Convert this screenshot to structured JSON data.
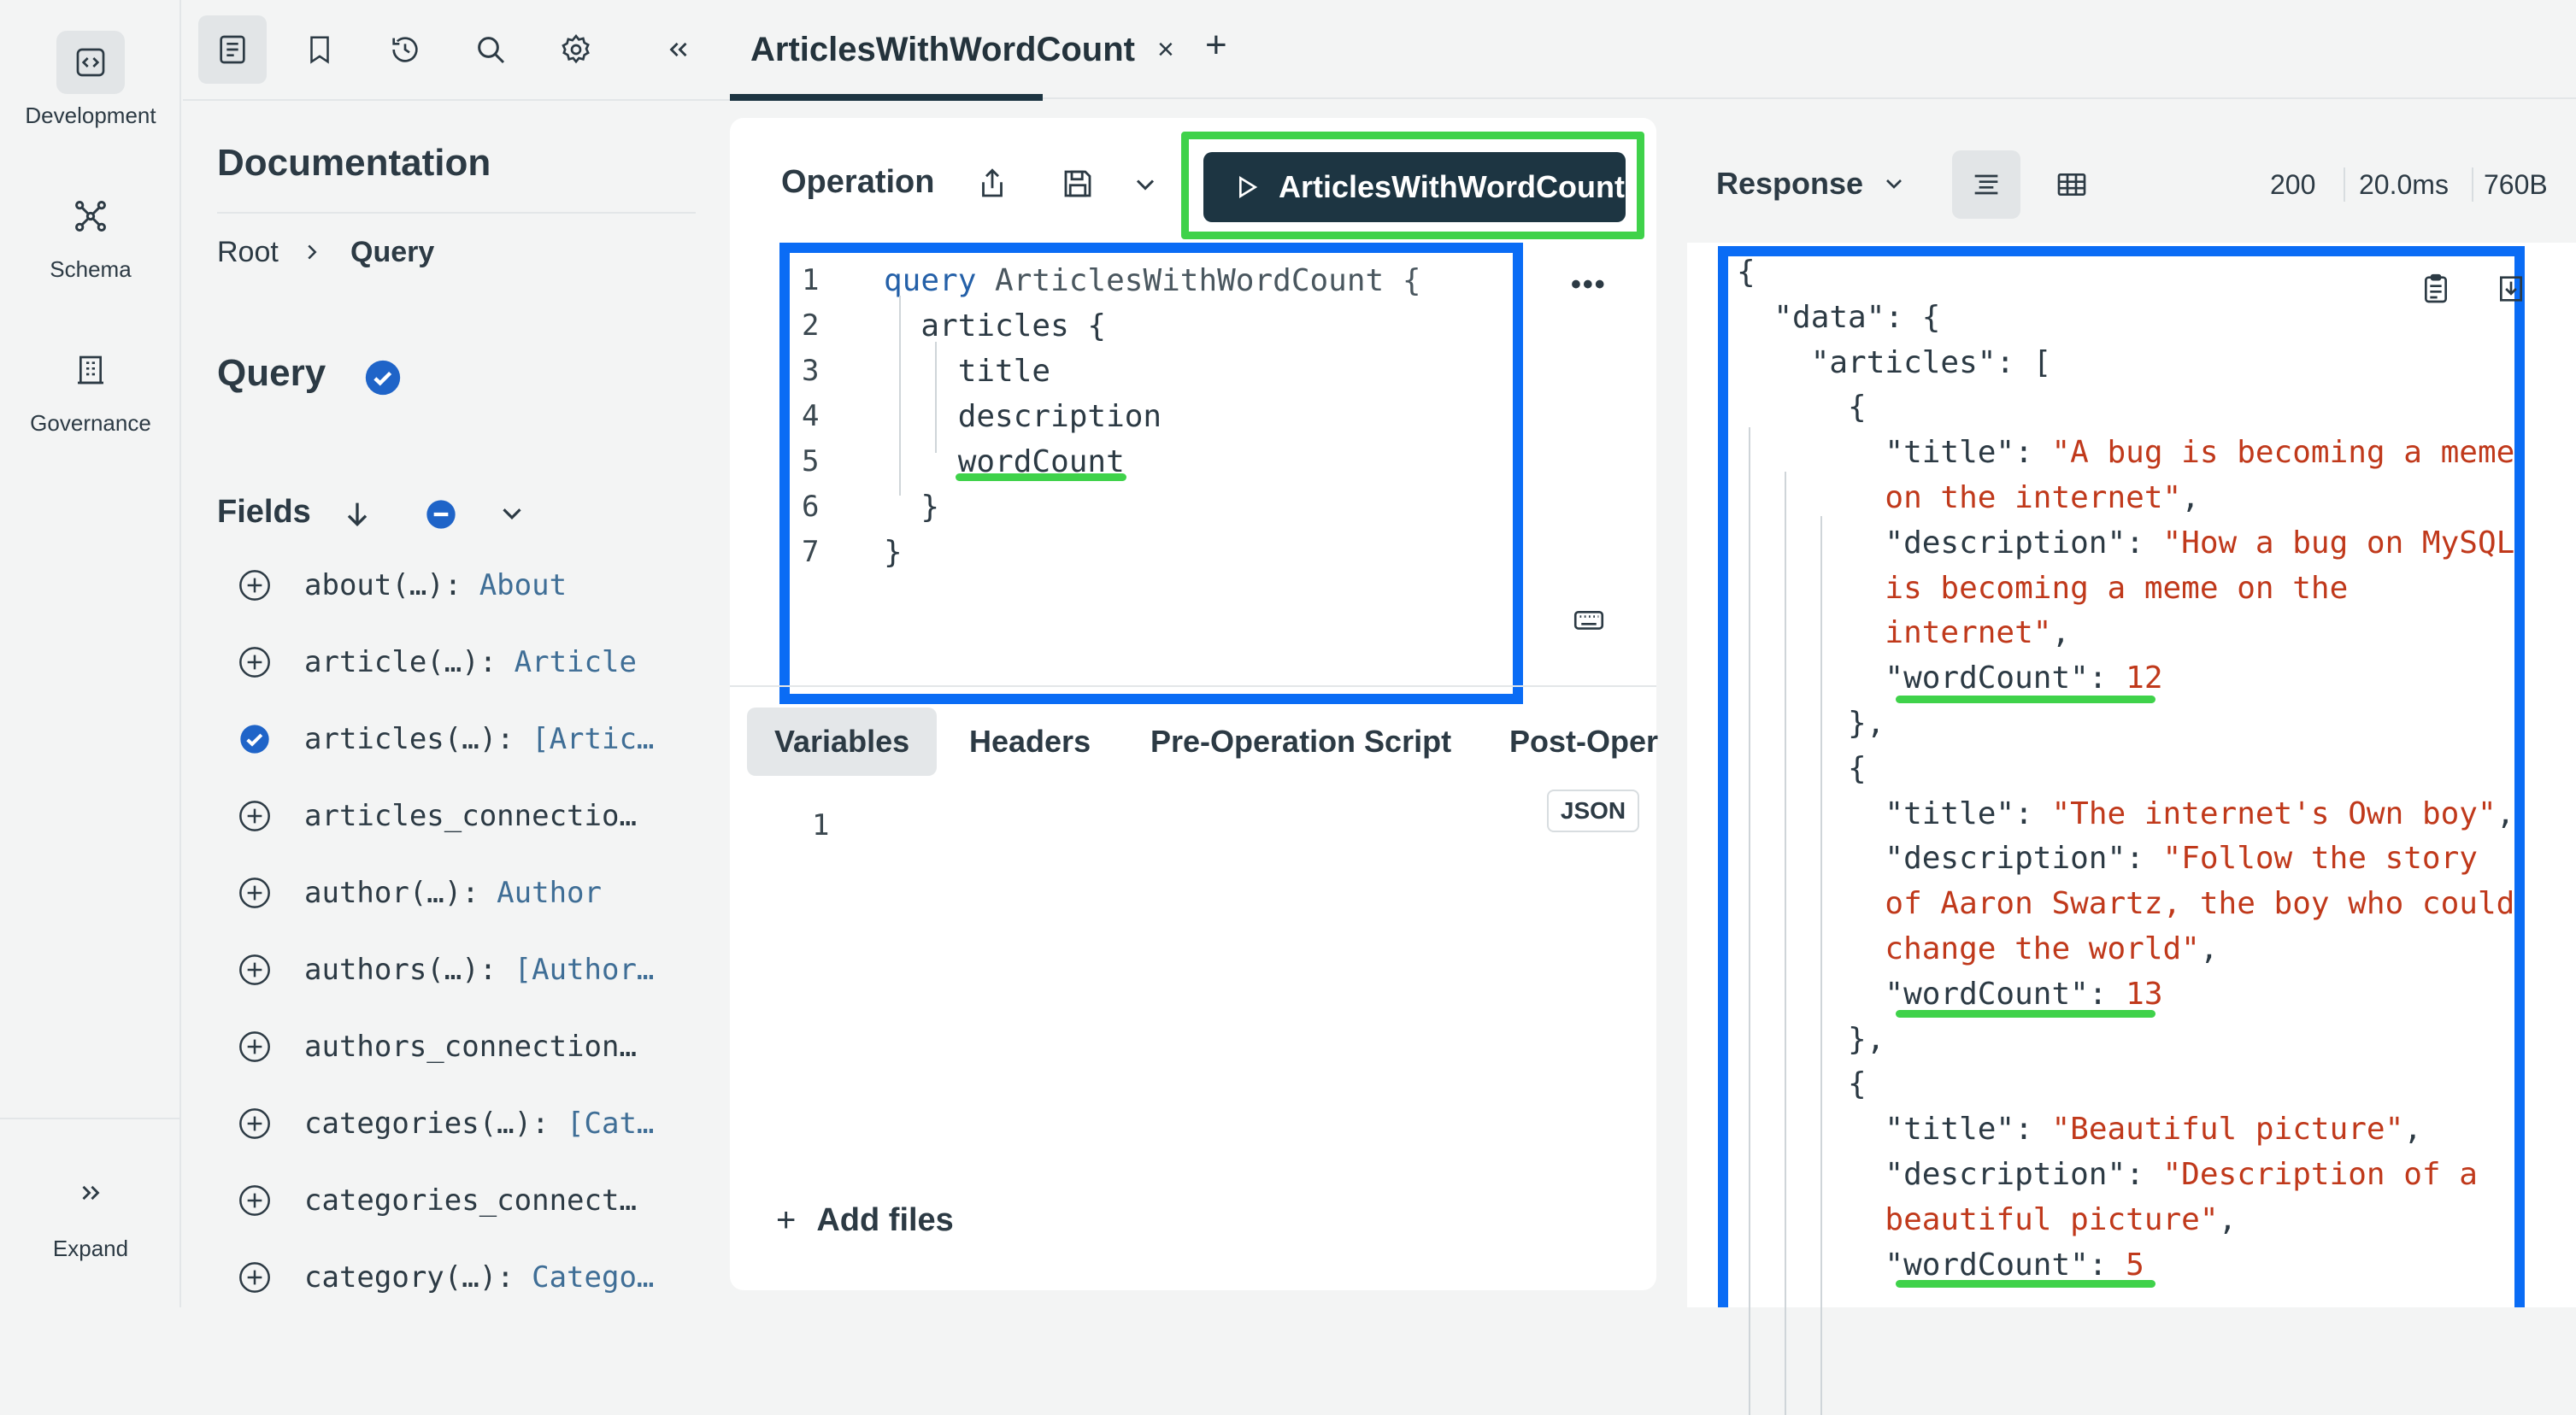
{
  "rail": {
    "items": [
      {
        "label": "Development",
        "icon": "code-brackets-icon"
      },
      {
        "label": "Schema",
        "icon": "graph-nodes-icon"
      },
      {
        "label": "Governance",
        "icon": "building-icon"
      }
    ],
    "expand_label": "Expand"
  },
  "docs": {
    "title": "Documentation",
    "breadcrumb": [
      "Root",
      "Query"
    ],
    "type_name": "Query",
    "fields_heading": "Fields",
    "fields": [
      {
        "name": "about(…): ",
        "type": "About",
        "selected": false
      },
      {
        "name": "article(…): ",
        "type": "Article",
        "selected": false
      },
      {
        "name": "articles(…): ",
        "type": "[Artic…",
        "selected": true
      },
      {
        "name": "articles_connectio…",
        "type": "",
        "selected": false
      },
      {
        "name": "author(…): ",
        "type": "Author",
        "selected": false
      },
      {
        "name": "authors(…): ",
        "type": "[Author…",
        "selected": false
      },
      {
        "name": "authors_connection…",
        "type": "",
        "selected": false
      },
      {
        "name": "categories(…): ",
        "type": "[Cat…",
        "selected": false
      },
      {
        "name": "categories_connect…",
        "type": "",
        "selected": false
      },
      {
        "name": "category(…): ",
        "type": "Catego…",
        "selected": false
      }
    ]
  },
  "tab": {
    "title": "ArticlesWithWordCount",
    "close": "×",
    "add": "+"
  },
  "operation": {
    "title": "Operation",
    "run_label": "ArticlesWithWordCount",
    "code_lines": [
      {
        "n": "1",
        "parts": [
          [
            "kw",
            "query"
          ],
          [
            "fn",
            " ArticlesWithWordCount {"
          ]
        ]
      },
      {
        "n": "2",
        "parts": [
          [
            "",
            "  articles {"
          ]
        ]
      },
      {
        "n": "3",
        "parts": [
          [
            "",
            "    title"
          ]
        ]
      },
      {
        "n": "4",
        "parts": [
          [
            "",
            "    description"
          ]
        ]
      },
      {
        "n": "5",
        "parts": [
          [
            "",
            "    wordCount"
          ]
        ]
      },
      {
        "n": "6",
        "parts": [
          [
            "",
            "  }"
          ]
        ]
      },
      {
        "n": "7",
        "parts": [
          [
            "",
            "}"
          ]
        ]
      }
    ],
    "sub_tabs": [
      "Variables",
      "Headers",
      "Pre-Operation Script",
      "Post-Oper"
    ],
    "variables_line": "1",
    "json_badge": "JSON",
    "add_files": "Add files"
  },
  "response": {
    "title": "Response",
    "status": "200",
    "time": "20.0ms",
    "size": "760B",
    "lines": [
      [
        [
          "",
          "{"
        ]
      ],
      [
        [
          "",
          "  \"data\": {"
        ]
      ],
      [
        [
          "",
          "    \"articles\": ["
        ]
      ],
      [
        [
          "",
          "      {"
        ]
      ],
      [
        [
          "",
          "        \"title\": "
        ],
        [
          "str",
          "\"A bug is becoming a meme"
        ]
      ],
      [
        [
          "str",
          "        on the internet\""
        ],
        [
          "",
          ","
        ]
      ],
      [
        [
          "",
          "        \"description\": "
        ],
        [
          "str",
          "\"How a bug on MySQL"
        ]
      ],
      [
        [
          "str",
          "        is becoming a meme on the"
        ]
      ],
      [
        [
          "str",
          "        internet\""
        ],
        [
          "",
          ","
        ]
      ],
      [
        [
          "",
          "        \"wordCount\": "
        ],
        [
          "num",
          "12"
        ]
      ],
      [
        [
          "",
          "      },"
        ]
      ],
      [
        [
          "",
          "      {"
        ]
      ],
      [
        [
          "",
          "        \"title\": "
        ],
        [
          "str",
          "\"The internet's Own boy\""
        ],
        [
          "",
          ","
        ]
      ],
      [
        [
          "",
          "        \"description\": "
        ],
        [
          "str",
          "\"Follow the story"
        ]
      ],
      [
        [
          "str",
          "        of Aaron Swartz, the boy who could"
        ]
      ],
      [
        [
          "str",
          "        change the world\""
        ],
        [
          "",
          ","
        ]
      ],
      [
        [
          "",
          "        \"wordCount\": "
        ],
        [
          "num",
          "13"
        ]
      ],
      [
        [
          "",
          "      },"
        ]
      ],
      [
        [
          "",
          "      {"
        ]
      ],
      [
        [
          "",
          "        \"title\": "
        ],
        [
          "str",
          "\"Beautiful picture\""
        ],
        [
          "",
          ","
        ]
      ],
      [
        [
          "",
          "        \"description\": "
        ],
        [
          "str",
          "\"Description of a"
        ]
      ],
      [
        [
          "str",
          "        beautiful picture\""
        ],
        [
          "",
          ","
        ]
      ],
      [
        [
          "",
          "        \"wordCount\": "
        ],
        [
          "num",
          "5"
        ]
      ]
    ]
  },
  "colors": {
    "accent_dark": "#1d3542",
    "highlight_green": "#3fd24a",
    "highlight_blue": "#0a6cf5",
    "string_red": "#c0391b"
  }
}
